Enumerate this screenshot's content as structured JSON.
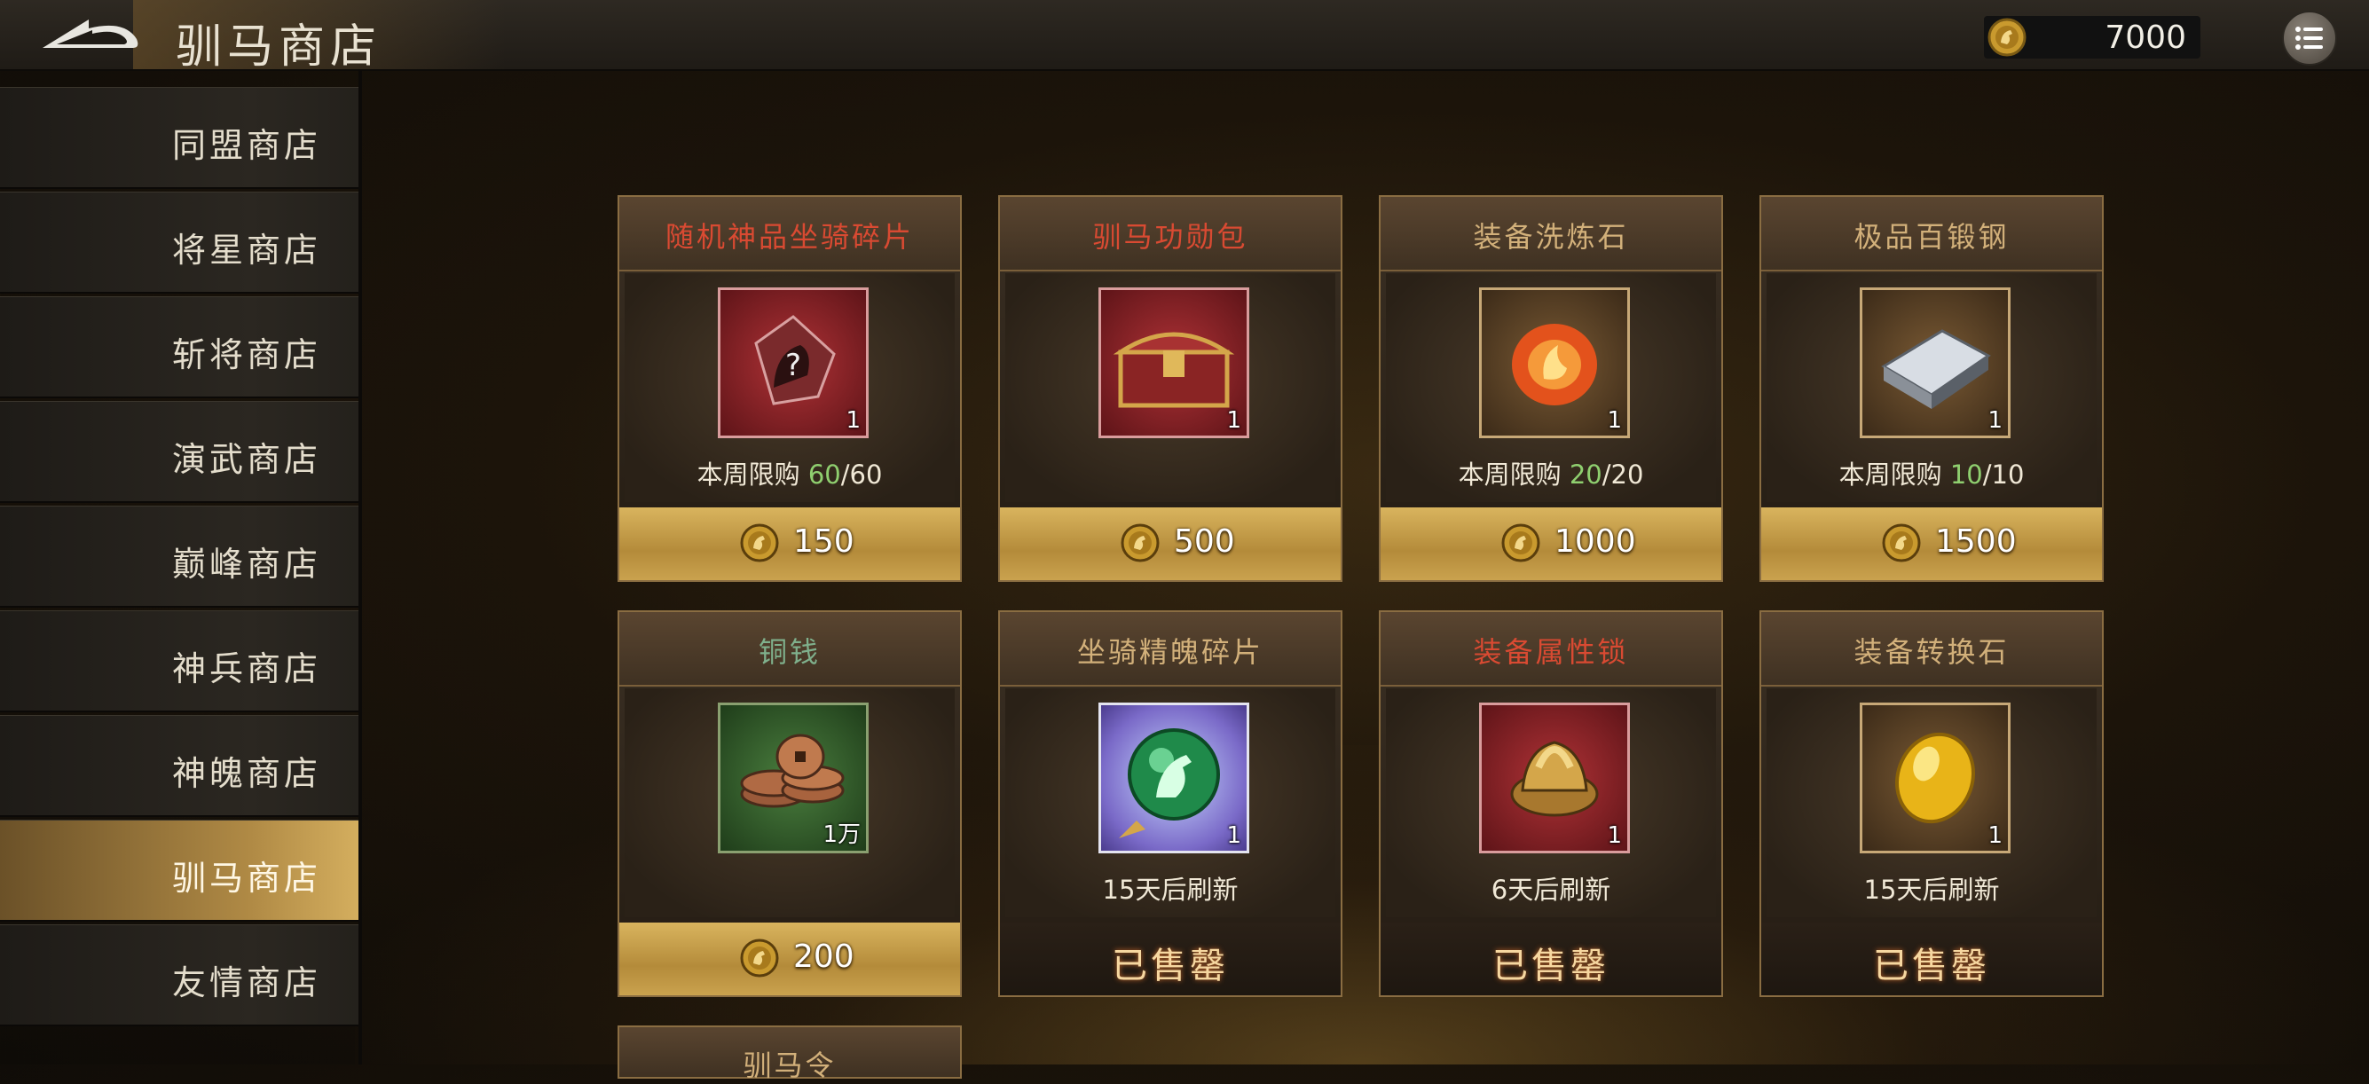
{
  "header": {
    "title": "驯马商店",
    "currency_value": "7000"
  },
  "sidebar": {
    "items": [
      {
        "label": "同盟商店",
        "active": false
      },
      {
        "label": "将星商店",
        "active": false
      },
      {
        "label": "斩将商店",
        "active": false
      },
      {
        "label": "演武商店",
        "active": false
      },
      {
        "label": "巅峰商店",
        "active": false
      },
      {
        "label": "神兵商店",
        "active": false
      },
      {
        "label": "神魄商店",
        "active": false
      },
      {
        "label": "驯马商店",
        "active": true
      },
      {
        "label": "友情商店",
        "active": false
      }
    ]
  },
  "cards": [
    {
      "name": "随机神品坐骑碎片",
      "icon": "mount-fragment-icon",
      "qty": "1",
      "info_prefix": "本周限购 ",
      "info_highlight": "60",
      "info_suffix": "/60",
      "price": "150",
      "sold": ""
    },
    {
      "name": "驯马功勋包",
      "icon": "treasure-chest-icon",
      "qty": "1",
      "info_prefix": "",
      "info_highlight": "",
      "info_suffix": "",
      "price": "500",
      "sold": ""
    },
    {
      "name": "装备洗炼石",
      "icon": "refine-stone-icon",
      "qty": "1",
      "info_prefix": "本周限购 ",
      "info_highlight": "20",
      "info_suffix": "/20",
      "price": "1000",
      "sold": ""
    },
    {
      "name": "极品百锻钢",
      "icon": "steel-ingot-icon",
      "qty": "1",
      "info_prefix": "本周限购 ",
      "info_highlight": "10",
      "info_suffix": "/10",
      "price": "1500",
      "sold": ""
    },
    {
      "name": "铜钱",
      "icon": "copper-coins-icon",
      "qty": "1万",
      "info_prefix": "",
      "info_highlight": "",
      "info_suffix": "",
      "price": "200",
      "sold": ""
    },
    {
      "name": "坐骑精魄碎片",
      "icon": "mount-soul-orb-icon",
      "qty": "1",
      "info_prefix": "15天后刷新",
      "info_highlight": "",
      "info_suffix": "",
      "price": "",
      "sold": "已售罄"
    },
    {
      "name": "装备属性锁",
      "icon": "attribute-lock-icon",
      "qty": "1",
      "info_prefix": "6天后刷新",
      "info_highlight": "",
      "info_suffix": "",
      "price": "",
      "sold": "已售罄"
    },
    {
      "name": "装备转换石",
      "icon": "conversion-stone-icon",
      "qty": "1",
      "info_prefix": "15天后刷新",
      "info_highlight": "",
      "info_suffix": "",
      "price": "",
      "sold": "已售罄"
    }
  ],
  "partial_card": {
    "name": "驯马令"
  },
  "colors": {
    "accent_gold": "#c9a24f",
    "name_red": "#d94a32",
    "name_tan": "#d2b07a",
    "highlight_green": "#8fcf6f"
  }
}
